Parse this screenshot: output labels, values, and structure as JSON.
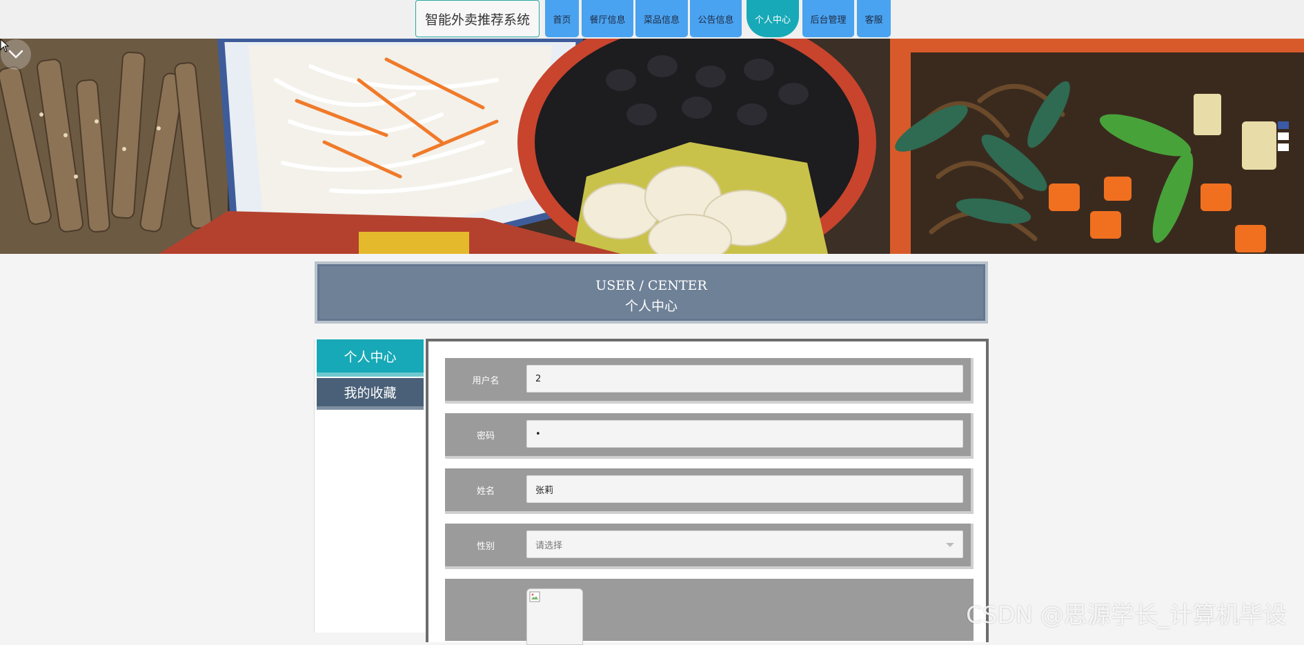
{
  "brand": {
    "title": "智能外卖推荐系统"
  },
  "nav": {
    "items": [
      {
        "label": "首页"
      },
      {
        "label": "餐厅信息"
      },
      {
        "label": "菜品信息"
      },
      {
        "label": "公告信息"
      },
      {
        "label": "个人中心",
        "active": true
      },
      {
        "label": "后台管理"
      },
      {
        "label": "客服"
      }
    ]
  },
  "banner": {
    "icon": "chevron-down-icon",
    "slides": 3,
    "active_slide": 1
  },
  "section": {
    "title_en": "USER / CENTER",
    "title_cn": "个人中心"
  },
  "side_menu": {
    "items": [
      {
        "label": "个人中心",
        "active": true
      },
      {
        "label": "我的收藏"
      }
    ]
  },
  "form": {
    "username": {
      "label": "用户名",
      "value": "2"
    },
    "password": {
      "label": "密码",
      "value": "•"
    },
    "name": {
      "label": "姓名",
      "value": "张莉"
    },
    "gender": {
      "label": "性别",
      "placeholder": "请选择"
    }
  },
  "watermark": "CSDN @思源学长_计算机毕设",
  "colors": {
    "nav_blue": "#4aa3f0",
    "accent_teal": "#17a9b7",
    "header_slate": "#6f8197",
    "row_gray": "#9b9b9b"
  }
}
